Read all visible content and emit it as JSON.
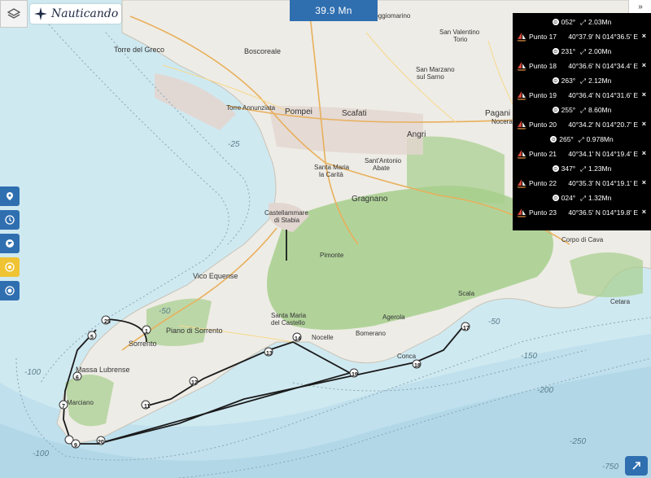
{
  "header": {
    "distance": "39.9 Mn",
    "logo_text": "Nauticando",
    "collapse_symbol": "»"
  },
  "panel": {
    "first_leg": {
      "bearing": "052°",
      "distance": "2.03Mn"
    },
    "waypoints": [
      {
        "name": "Punto 17",
        "coords": "40°37.9' N  014°36.5' E",
        "leg": {
          "bearing": "231°",
          "distance": "2.00Mn"
        }
      },
      {
        "name": "Punto 18",
        "coords": "40°36.6' N  014°34.4' E",
        "leg": {
          "bearing": "263°",
          "distance": "2.12Mn"
        }
      },
      {
        "name": "Punto 19",
        "coords": "40°36.4' N  014°31.6' E",
        "leg": {
          "bearing": "255°",
          "distance": "8.60Mn"
        }
      },
      {
        "name": "Punto 20",
        "coords": "40°34.2' N  014°20.7' E",
        "leg": {
          "bearing": "265°",
          "distance": "0.978Mn"
        }
      },
      {
        "name": "Punto 21",
        "coords": "40°34.1' N  014°19.4' E",
        "leg": {
          "bearing": "347°",
          "distance": "1.23Mn"
        }
      },
      {
        "name": "Punto 22",
        "coords": "40°35.3' N  014°19.1' E",
        "leg": {
          "bearing": "024°",
          "distance": "1.32Mn"
        }
      },
      {
        "name": "Punto 23",
        "coords": "40°36.5' N  014°19.8' E",
        "leg": null
      }
    ],
    "close_symbol": "×"
  },
  "map": {
    "places": {
      "torre_del_greco": "Torre del Greco",
      "boscoreale": "Boscoreale",
      "pompei": "Pompei",
      "scafati": "Scafati",
      "pagani": "Pagani",
      "nocera": "Nocera",
      "angri": "Angri",
      "san_marzano": "San Marzano sul Sarno",
      "san_valentino": "San Valentino Torio",
      "poggiomarino": "Poggiomarino",
      "torre_annunziata": "Torre Annunziata",
      "santa_maria_carita": "Santa Maria la Carità",
      "sant_antonio_abate": "Sant'Antonio Abate",
      "castellammare": "Castellammare di Stabia",
      "gragnano": "Gragnano",
      "vico_equense": "Vico Equense",
      "piano_di_sorrento": "Piano di Sorrento",
      "sorrento": "Sorrento",
      "massa_lubrense": "Massa Lubrense",
      "marciano": "Marciano",
      "pimonte": "Pimonte",
      "agerola": "Agerola",
      "scala": "Scala",
      "corpo_di_cava": "Corpo di Cava",
      "cetara": "Cetara",
      "nocelle": "Nocelle",
      "conca": "Conca",
      "santa_maria_castello": "Santa Maria del Castello",
      "bomerano": "Bomerano"
    },
    "depths": [
      "-25",
      "-50",
      "-100",
      "-150",
      "-200",
      "-250",
      "-750"
    ],
    "route_markers": [
      "25",
      "1",
      "5",
      "6",
      "7",
      "8",
      "9",
      "20",
      "11",
      "12",
      "13",
      "14",
      "19",
      "18",
      "17",
      "21"
    ],
    "colors": {
      "sea": "#cfe9f1",
      "land": "#eeece6",
      "forest": "#a6cf8c",
      "route": "#1a1a1a",
      "accent": "#2f6fb0",
      "active": "#f0c333"
    }
  },
  "tools": {
    "icons": [
      "pin-icon",
      "clock-icon",
      "globe-icon",
      "target-icon",
      "record-icon"
    ]
  }
}
